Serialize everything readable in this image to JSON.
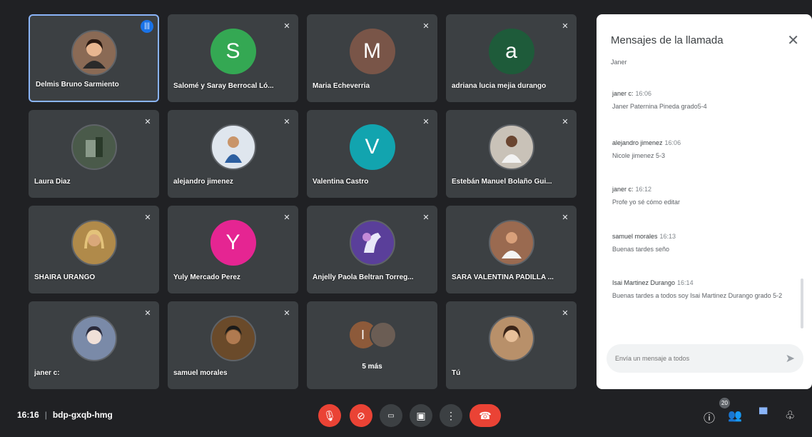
{
  "participants": [
    {
      "name": "Delmis Bruno Sarmiento",
      "avatar": "photo",
      "color": "#8a6a55",
      "speaking": true
    },
    {
      "name": "Salomé y Saray Berrocal Ló...",
      "avatar": "letter",
      "letter": "S",
      "color": "#34a853"
    },
    {
      "name": "Maria Echeverria",
      "avatar": "letter",
      "letter": "M",
      "color": "#795548"
    },
    {
      "name": "adriana lucia mejia durango",
      "avatar": "letter",
      "letter": "a",
      "color": "#1e5b3a"
    },
    {
      "name": "Laura Diaz",
      "avatar": "photo",
      "color": "#4a5a4a"
    },
    {
      "name": "alejandro jimenez",
      "avatar": "photo",
      "color": "#dfe6ee"
    },
    {
      "name": "Valentina Castro",
      "avatar": "letter",
      "letter": "V",
      "color": "#12a4af"
    },
    {
      "name": "Estebán Manuel Bolaño Gui...",
      "avatar": "photo",
      "color": "#c9c2b8"
    },
    {
      "name": "SHAIRA URANGO",
      "avatar": "photo",
      "color": "#b08a4a"
    },
    {
      "name": "Yuly Mercado Perez",
      "avatar": "letter",
      "letter": "Y",
      "color": "#e52592"
    },
    {
      "name": "Anjelly Paola Beltran Torreg...",
      "avatar": "photo",
      "color": "#5a3f9a"
    },
    {
      "name": "SARA VALENTINA PADILLA ...",
      "avatar": "photo",
      "color": "#9a6a50"
    },
    {
      "name": "janer c:",
      "avatar": "photo",
      "color": "#7a8aa8"
    },
    {
      "name": "samuel morales",
      "avatar": "photo",
      "color": "#6a4a2a"
    },
    {
      "name": "5 más",
      "avatar": "group",
      "letter": "I",
      "color": "#8d5a3a"
    },
    {
      "name": "Tú",
      "avatar": "photo",
      "color": "#b8906a"
    }
  ],
  "chat": {
    "title": "Mensajes de la llamada",
    "cut_line": "Janer",
    "messages": [
      {
        "sender": "janer c:",
        "time": "16:06",
        "text": "Janer Paternina Pineda grado5-4"
      },
      {
        "sender": "alejandro jimenez",
        "time": "16:06",
        "text": "Nicole jimenez 5-3"
      },
      {
        "sender": "janer c:",
        "time": "16:12",
        "text": "Profe yo sé cómo editar"
      },
      {
        "sender": "samuel morales",
        "time": "16:13",
        "text": "Buenas tardes seño"
      },
      {
        "sender": "Isai Martinez Durango",
        "time": "16:14",
        "text": "Buenas tardes a todos soy Isai Martinez Durango grado 5-2"
      }
    ],
    "input_placeholder": "Envía un mensaje a todos"
  },
  "bottom_bar": {
    "time": "16:16",
    "meeting_code": "bdp-gxqb-hmg",
    "participant_count": "20"
  },
  "colors": {
    "background": "#202124",
    "tile": "#3c4043",
    "accent": "#8ab4f8",
    "danger": "#ea4335",
    "chat_icon": "#8ab4f8"
  }
}
